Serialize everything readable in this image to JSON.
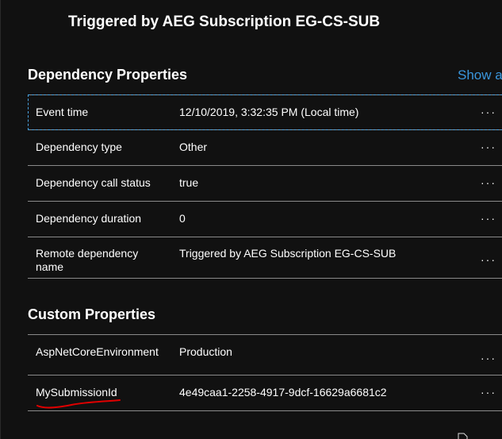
{
  "title": "Triggered by AEG Subscription EG-CS-SUB",
  "dependency_section": {
    "header": "Dependency Properties",
    "show_all": "Show a",
    "rows": [
      {
        "name": "Event time",
        "value": "12/10/2019, 3:32:35 PM (Local time)",
        "more": "···"
      },
      {
        "name": "Dependency type",
        "value": "Other",
        "more": "···"
      },
      {
        "name": "Dependency call status",
        "value": "true",
        "more": "···"
      },
      {
        "name": "Dependency duration",
        "value": "0",
        "more": "···"
      },
      {
        "name": "Remote dependency name",
        "value": "Triggered by AEG Subscription EG-CS-SUB",
        "more": "···"
      }
    ]
  },
  "custom_section": {
    "header": "Custom Properties",
    "rows": [
      {
        "name": "AspNetCoreEnvironment",
        "value": "Production",
        "more": "···"
      },
      {
        "name": "MySubmissionId",
        "value": "4e49caa1-2258-4917-9dcf-16629a6681c2",
        "more": "···"
      }
    ]
  },
  "colors": {
    "background": "#111111",
    "link": "#3a96dd",
    "focus_outline": "#4aa3df",
    "annotation": "#e00000"
  }
}
